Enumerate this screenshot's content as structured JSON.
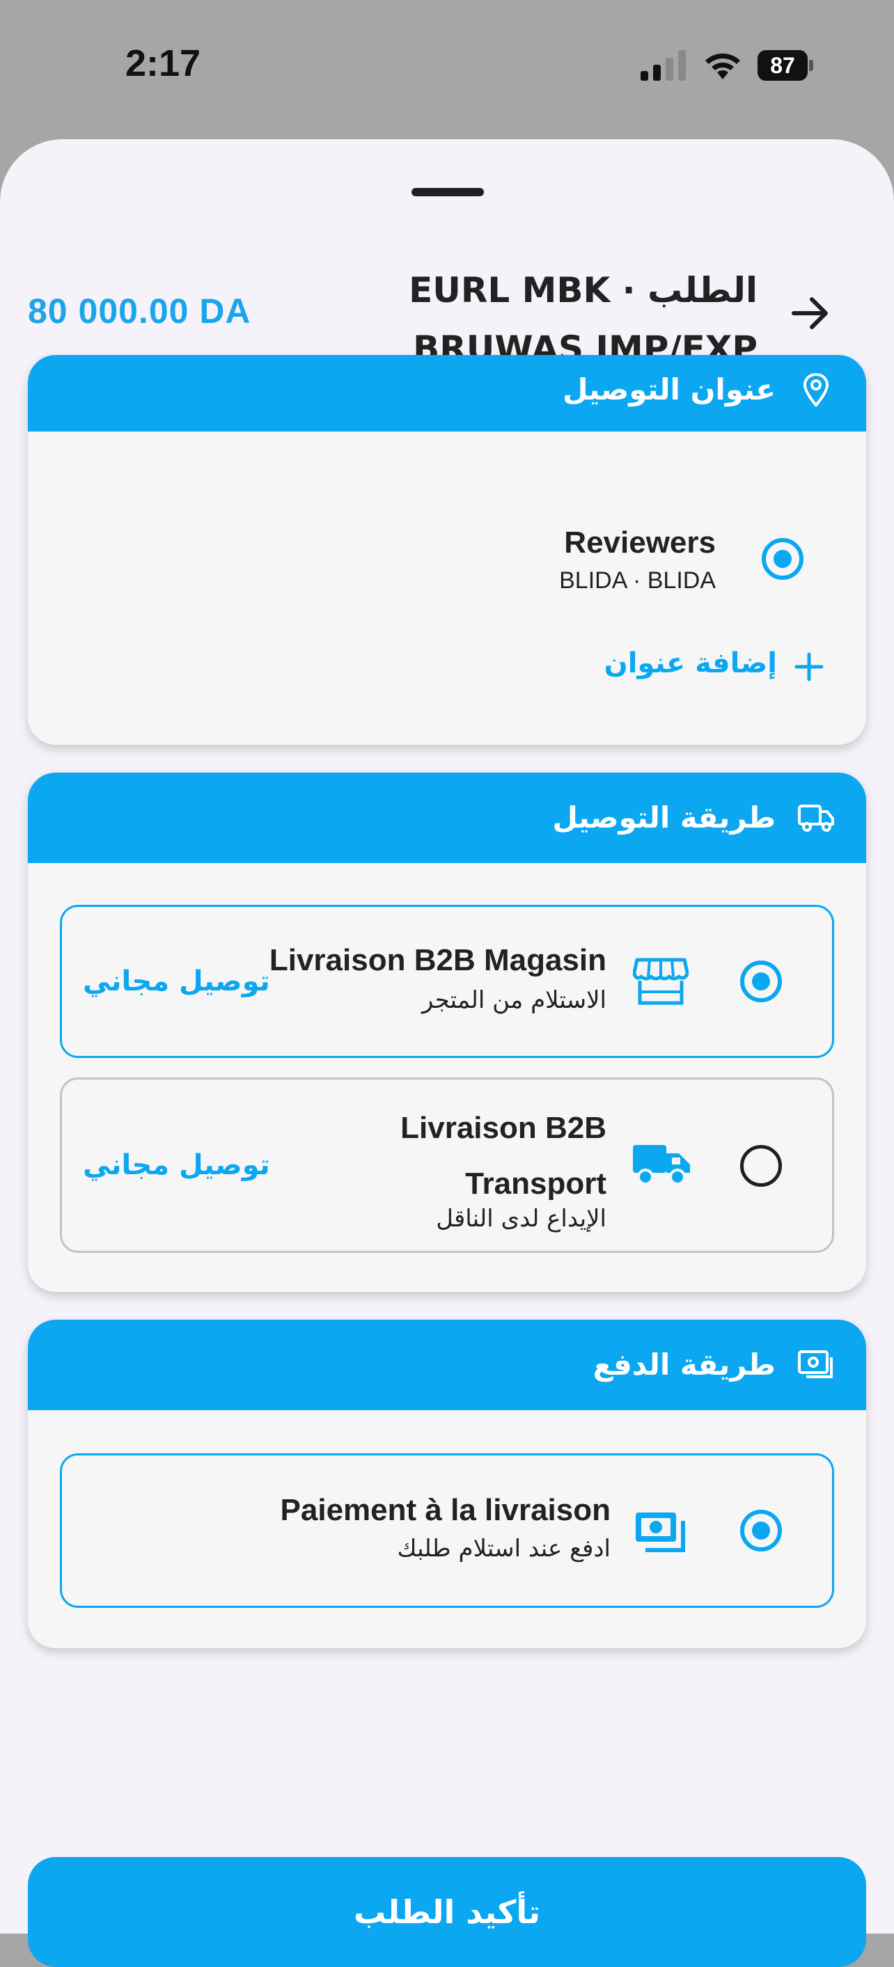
{
  "status_bar": {
    "time": "2:17",
    "battery": "87"
  },
  "header": {
    "amount": "80 000.00 DA",
    "title": "EURL MBK · الطلب BRUWAS IMP/EXP"
  },
  "address_section": {
    "title": "عنوان التوصيل",
    "address": {
      "name": "Reviewers",
      "detail": "BLIDA · BLIDA",
      "selected": true
    },
    "add_label": "إضافة عنوان"
  },
  "delivery_section": {
    "title": "طريقة التوصيل",
    "options": [
      {
        "name": "Livraison B2B Magasin",
        "subtitle": "الاستلام من المتجر",
        "price": "توصيل مجاني",
        "icon": "store-icon",
        "selected": true
      },
      {
        "name": "Livraison B2B Transport",
        "subtitle": "الإيداع لدى الناقل",
        "price": "توصيل مجاني",
        "icon": "truck-icon",
        "selected": false
      }
    ]
  },
  "payment_section": {
    "title": "طريقة الدفع",
    "options": [
      {
        "name": "Paiement à la livraison",
        "subtitle": "ادفع عند استلام طلبك",
        "icon": "cash-icon",
        "selected": true
      }
    ]
  },
  "confirm_label": "تأكيد الطلب",
  "colors": {
    "accent": "#0ba7f1",
    "sheet_bg": "#f6f2fa",
    "card_bg": "#f6f6f6"
  }
}
